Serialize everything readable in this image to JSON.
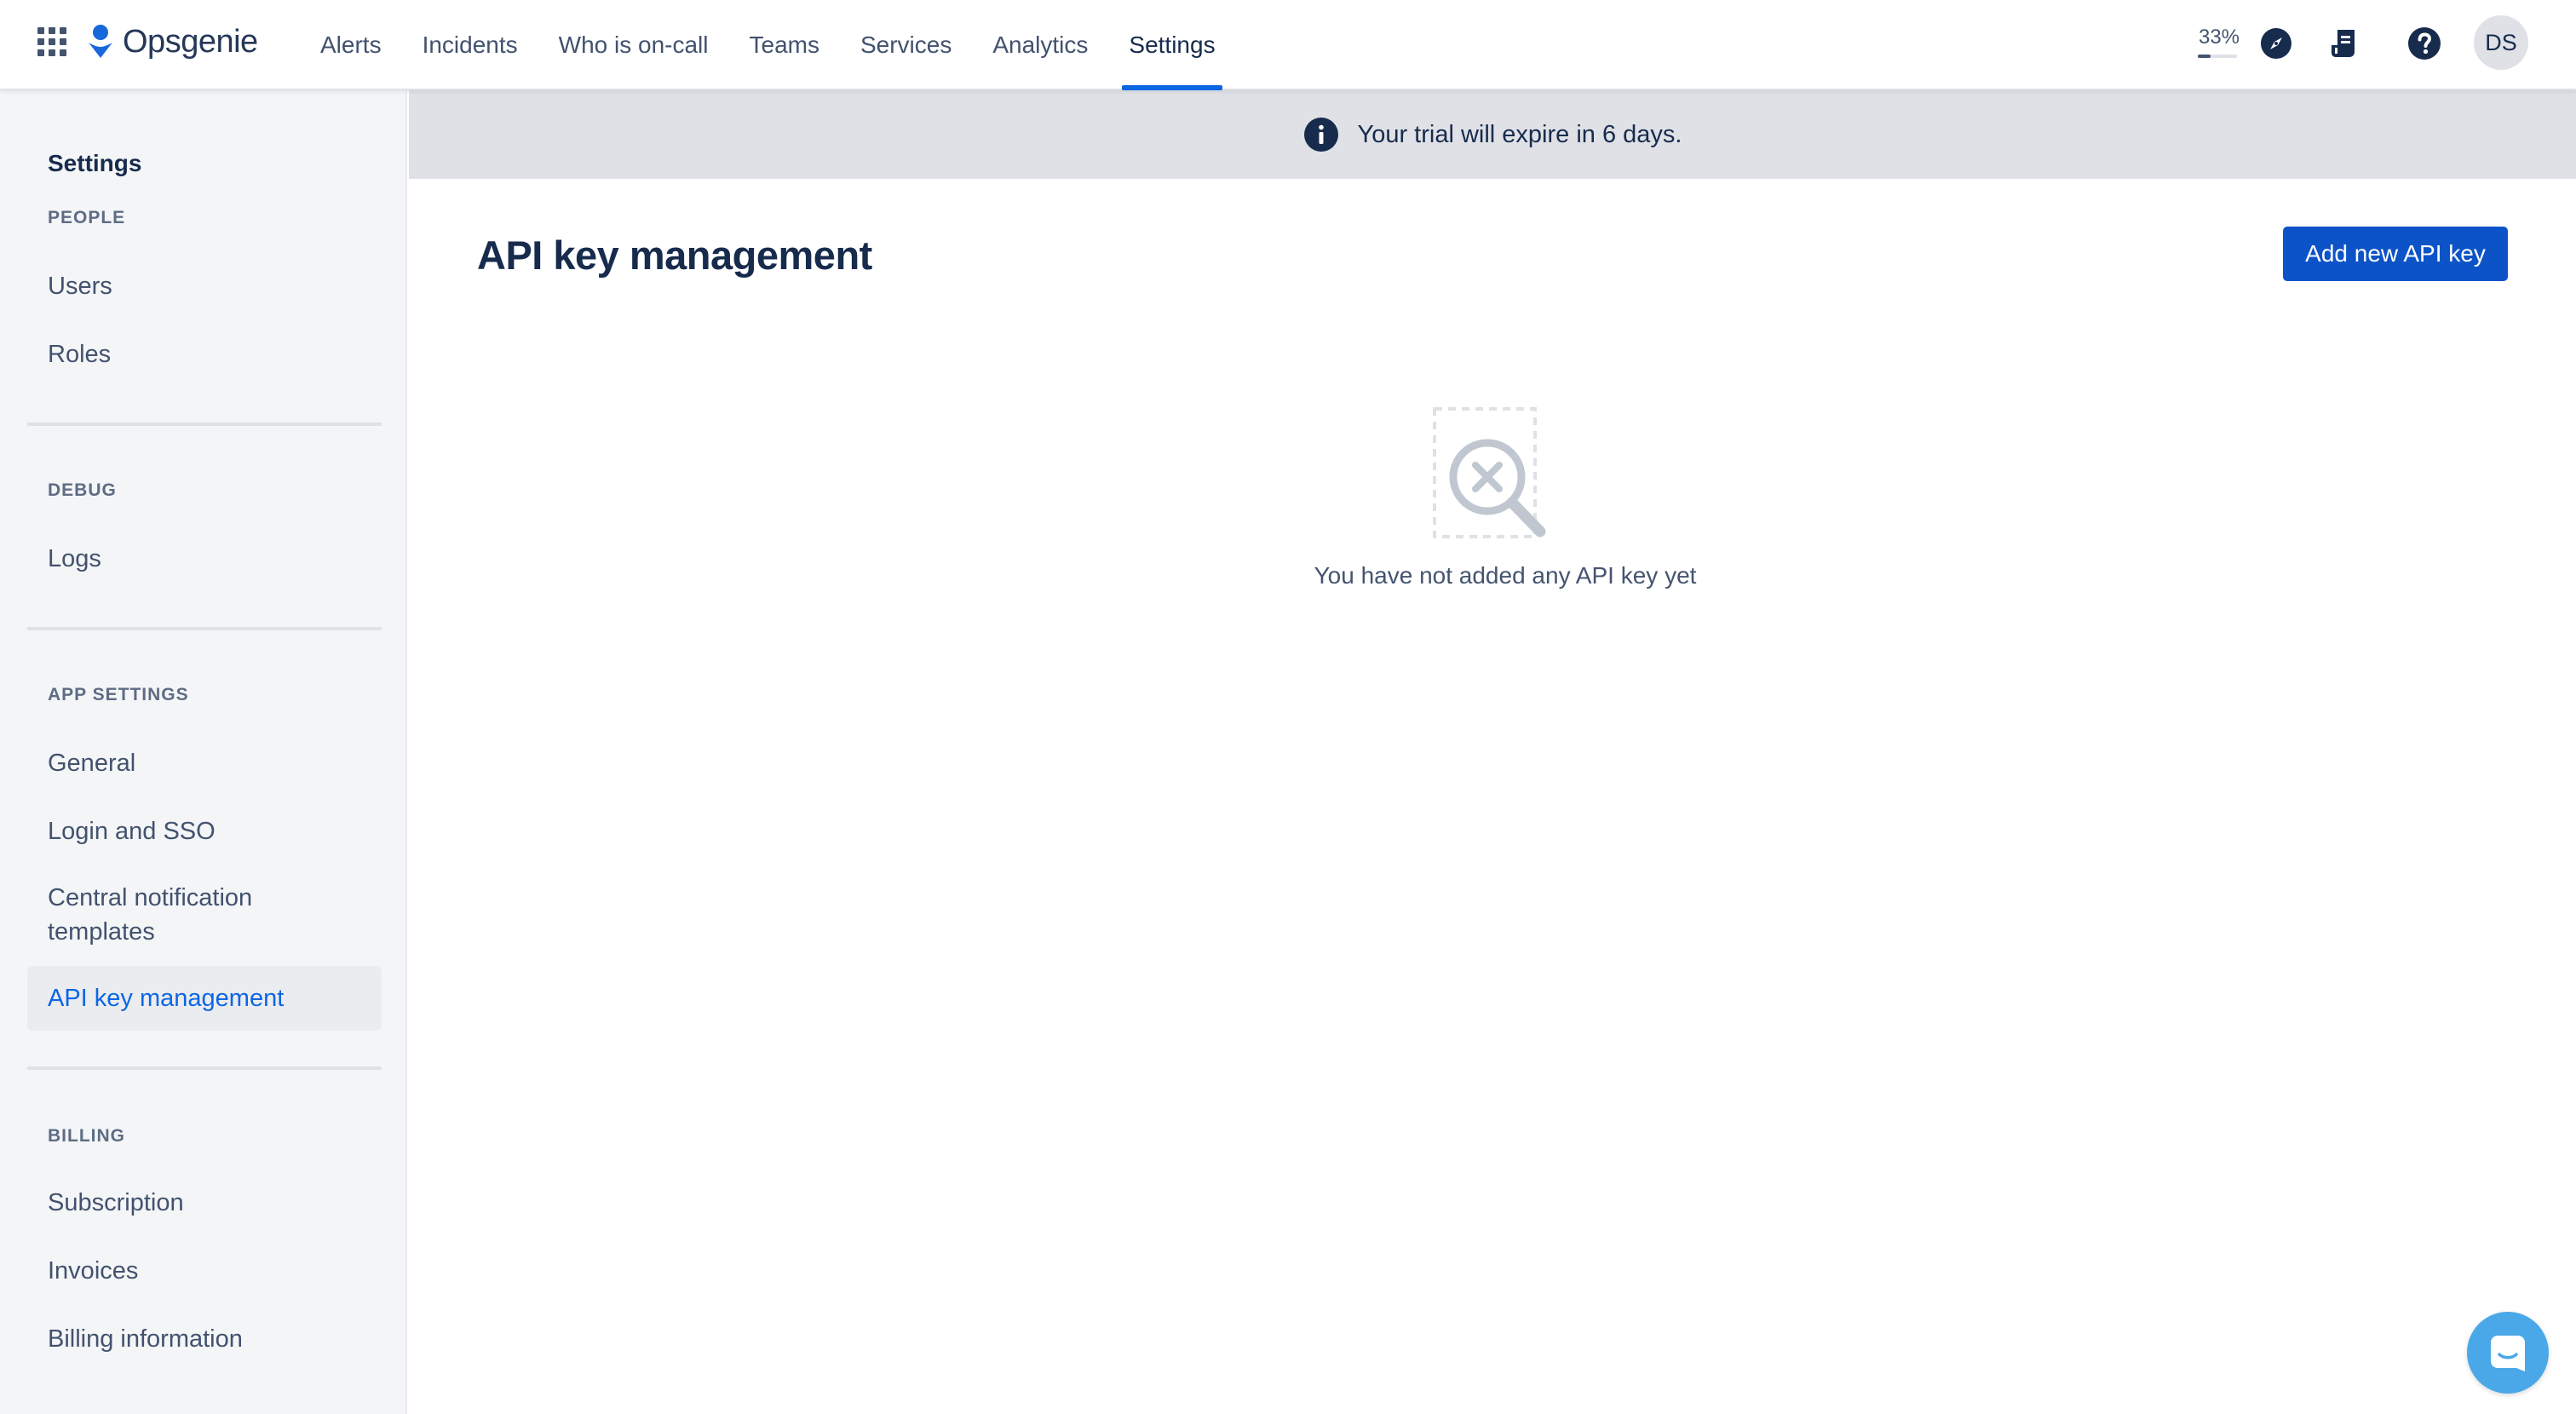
{
  "app": {
    "name": "Opsgenie",
    "brand_color": "#1868db"
  },
  "nav": {
    "tabs": [
      {
        "label": "Alerts"
      },
      {
        "label": "Incidents"
      },
      {
        "label": "Who is on-call"
      },
      {
        "label": "Teams"
      },
      {
        "label": "Services"
      },
      {
        "label": "Analytics"
      },
      {
        "label": "Settings",
        "active": true
      }
    ],
    "progress_label": "33%",
    "progress_value": 0.33,
    "icons": [
      "app-switcher-icon",
      "compass-icon",
      "release-notes-icon",
      "help-icon"
    ],
    "avatar_initials": "DS"
  },
  "sidebar": {
    "title": "Settings",
    "sections": [
      {
        "heading": "PEOPLE",
        "items": [
          {
            "label": "Users"
          },
          {
            "label": "Roles"
          }
        ]
      },
      {
        "heading": "DEBUG",
        "items": [
          {
            "label": "Logs"
          }
        ]
      },
      {
        "heading": "APP SETTINGS",
        "items": [
          {
            "label": "General"
          },
          {
            "label": "Login and SSO"
          },
          {
            "label": "Central notification templates"
          },
          {
            "label": "API key management",
            "selected": true
          }
        ]
      },
      {
        "heading": "BILLING",
        "items": [
          {
            "label": "Subscription"
          },
          {
            "label": "Invoices"
          },
          {
            "label": "Billing information"
          }
        ]
      }
    ]
  },
  "banner": {
    "text": "Your trial will expire in 6 days.",
    "icon": "info-icon"
  },
  "main": {
    "title": "API key management",
    "add_button_label": "Add new API key",
    "empty_state_text": "You have not added any API key yet",
    "empty_state_icon": "search-no-results-icon"
  },
  "chat": {
    "icon": "chat-icon",
    "color": "#4ba8e8"
  }
}
